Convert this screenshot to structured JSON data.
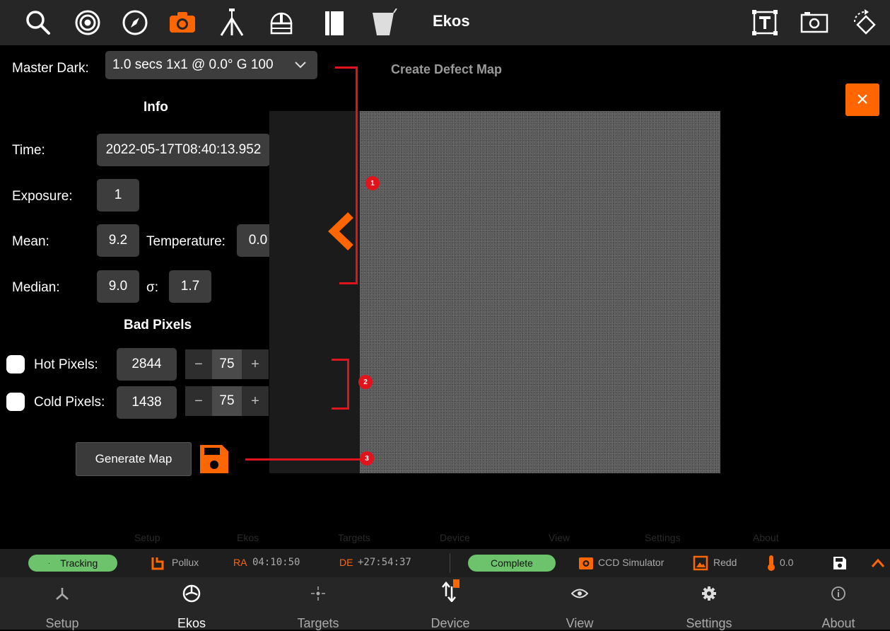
{
  "toolbar": {
    "title": "Ekos",
    "icons": [
      "search-icon",
      "target-icon",
      "compass-icon",
      "camera-icon",
      "telescope-icon",
      "dome-icon",
      "dust-cap-icon",
      "flat-panel-icon",
      "text-frame-icon",
      "image-frame-icon",
      "rotate-icon"
    ],
    "active_color": "#ff6600"
  },
  "panel": {
    "master_dark_label": "Master Dark:",
    "master_dark_value": "1.0 secs 1x1 @ 0.0° G 100",
    "info_header": "Info",
    "time_label": "Time:",
    "time_value": "2022-05-17T08:40:13.952",
    "exposure_label": "Exposure:",
    "exposure_value": "1",
    "mean_label": "Mean:",
    "mean_value": "9.2",
    "temperature_label": "Temperature:",
    "temperature_value": "0.0",
    "median_label": "Median:",
    "median_value": "9.0",
    "sigma_label": "σ:",
    "sigma_value": "1.7",
    "bad_pixels_header": "Bad Pixels",
    "hot_label": "Hot Pixels:",
    "hot_count": "2844",
    "hot_threshold": "75",
    "cold_label": "Cold Pixels:",
    "cold_count": "1438",
    "cold_threshold": "75",
    "minus": "−",
    "plus": "+",
    "generate_label": "Generate Map"
  },
  "viewer": {
    "title": "Create Defect Map",
    "close_symbol": "×",
    "markers": [
      "1",
      "2",
      "3"
    ]
  },
  "ghost_labels": [
    "Setup",
    "Ekos",
    "Targets",
    "Device",
    "View",
    "Settings",
    "About"
  ],
  "status": {
    "tracking": "Tracking",
    "target": "Pollux",
    "ra_label": "RA",
    "ra_value": "04:10:50",
    "de_label": "DE",
    "de_value": "+27:54:37",
    "complete": "Complete",
    "camera": "CCD Simulator",
    "filter": "Redd",
    "temperature": "0.0"
  },
  "nav": {
    "items": [
      {
        "label": "Setup",
        "icon": "setup-icon"
      },
      {
        "label": "Ekos",
        "icon": "ekos-icon"
      },
      {
        "label": "Targets",
        "icon": "targets-icon"
      },
      {
        "label": "Device",
        "icon": "device-icon"
      },
      {
        "label": "View",
        "icon": "view-icon"
      },
      {
        "label": "Settings",
        "icon": "settings-icon"
      },
      {
        "label": "About",
        "icon": "about-icon"
      }
    ]
  }
}
